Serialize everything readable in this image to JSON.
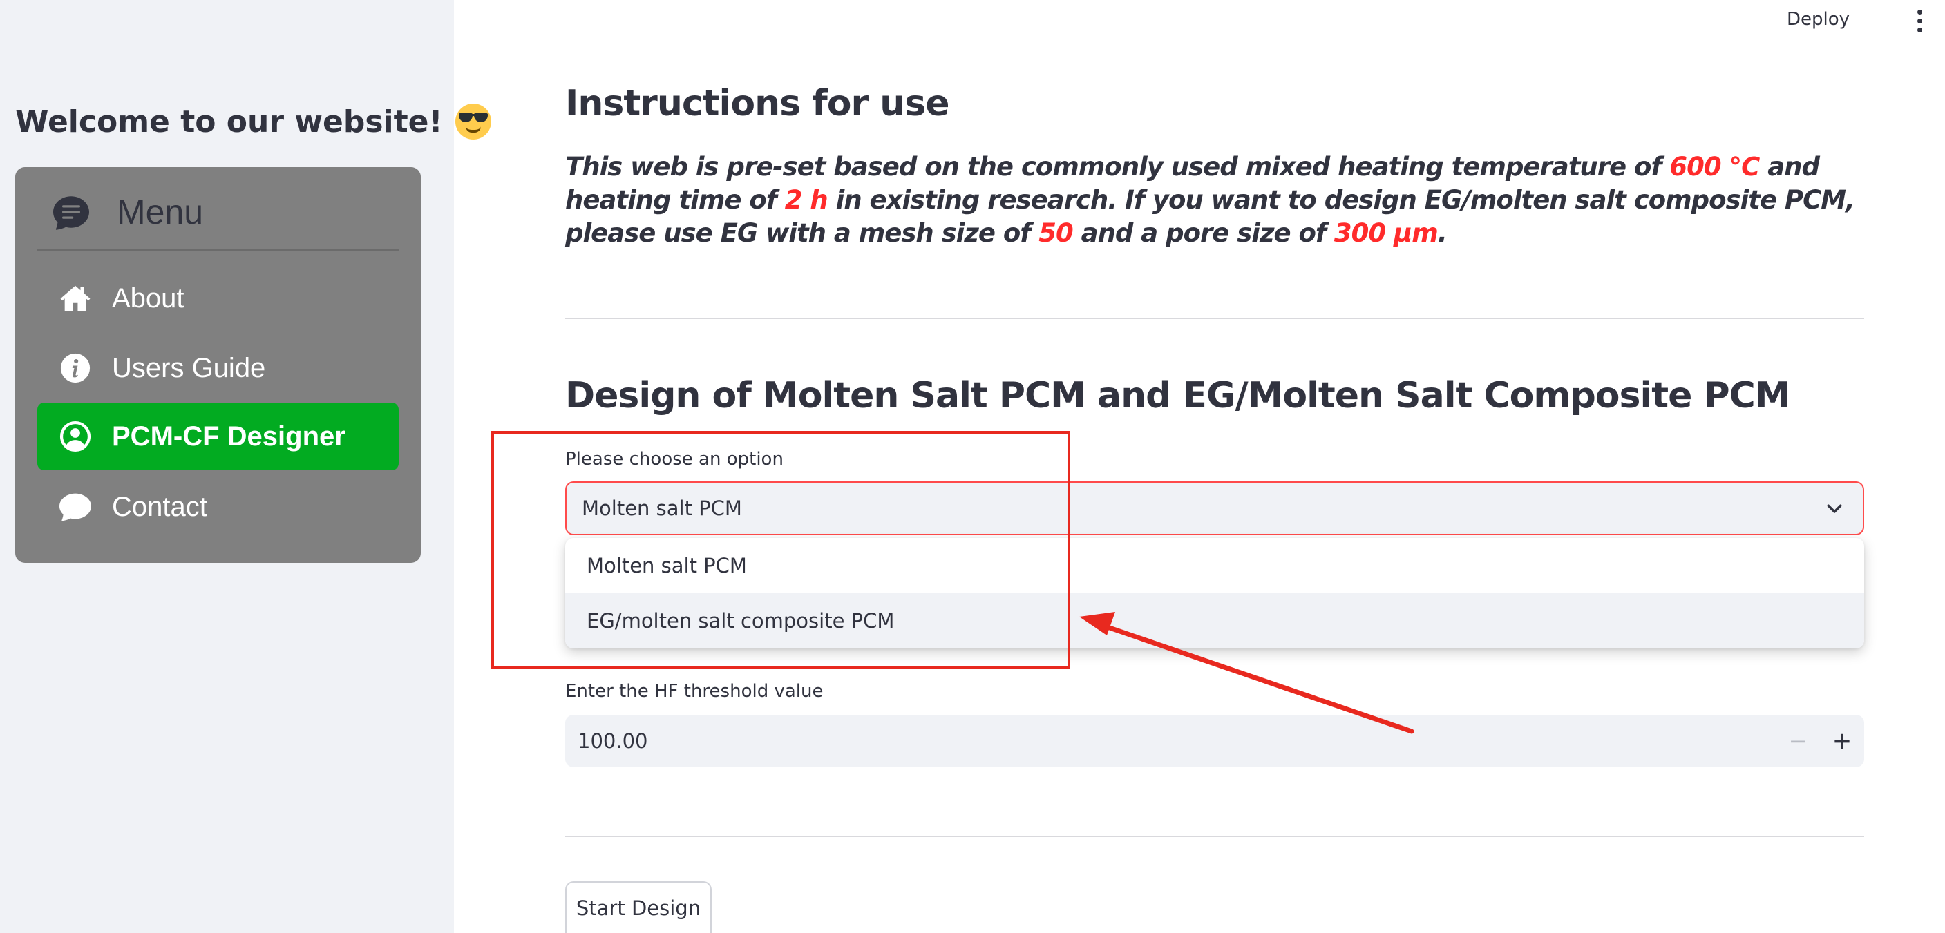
{
  "header": {
    "deploy_label": "Deploy"
  },
  "sidebar": {
    "welcome_text": "Welcome to our website!",
    "welcome_emoji_icon": "smiling-face-with-sunglasses-icon",
    "menu_title": "Menu",
    "menu_icon": "chat-text-icon",
    "items": [
      {
        "label": "About",
        "icon": "house-icon",
        "active": false
      },
      {
        "label": "Users Guide",
        "icon": "info-circle-icon",
        "active": false
      },
      {
        "label": "PCM-CF Designer",
        "icon": "person-circle-icon",
        "active": true
      },
      {
        "label": "Contact",
        "icon": "chat-icon",
        "active": false
      }
    ],
    "background_color": "#f0f2f6",
    "menu_background_color": "#808080",
    "active_color": "#02ab21"
  },
  "main": {
    "instructions_title": "Instructions for use",
    "instructions": {
      "t1": "This web is pre-set based on the commonly used mixed heating temperature of ",
      "temp": "600 ℃",
      "t2": " and heating time of ",
      "time": "2 h",
      "t3": " in existing research. If you want to design EG/molten salt composite PCM, please use EG with a mesh size of ",
      "mesh": "50",
      "t4": " and a pore size of ",
      "pore": "300 μm",
      "t5": "."
    },
    "design_title": "Design of Molten Salt PCM and EG/Molten Salt Composite PCM",
    "select": {
      "label": "Please choose an option",
      "value": "Molten salt PCM",
      "options": [
        "Molten salt PCM",
        "EG/molten salt composite PCM"
      ],
      "highlighted_option": "EG/molten salt composite PCM"
    },
    "threshold": {
      "label": "Enter the HF threshold value",
      "value": "100.00",
      "decrement_label": "−",
      "increment_label": "+"
    },
    "start_button_label": "Start Design"
  },
  "accent_color": "#ff4b4b",
  "highlight_text_color": "#ff2b2b",
  "annotation_color": "#e8291f"
}
